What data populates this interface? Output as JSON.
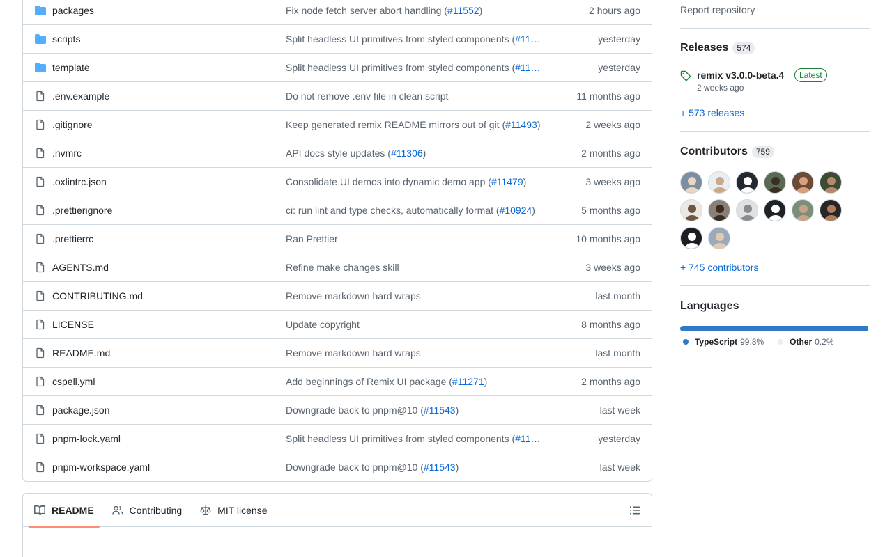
{
  "files": [
    {
      "type": "folder",
      "name": "packages",
      "message": "Fix node fetch server abort handling (",
      "pr": "#11552",
      "suffix": ")",
      "time": "2 hours ago"
    },
    {
      "type": "folder",
      "name": "scripts",
      "message": "Split headless UI primitives from styled components (",
      "pr": "#11…",
      "suffix": "",
      "time": "yesterday"
    },
    {
      "type": "folder",
      "name": "template",
      "message": "Split headless UI primitives from styled components (",
      "pr": "#11…",
      "suffix": "",
      "time": "yesterday"
    },
    {
      "type": "file",
      "name": ".env.example",
      "message": "Do not remove .env file in clean script",
      "pr": "",
      "suffix": "",
      "time": "11 months ago"
    },
    {
      "type": "file",
      "name": ".gitignore",
      "message": "Keep generated remix README mirrors out of git (",
      "pr": "#11493",
      "suffix": ")",
      "time": "2 weeks ago"
    },
    {
      "type": "file",
      "name": ".nvmrc",
      "message": "API docs style updates (",
      "pr": "#11306",
      "suffix": ")",
      "time": "2 months ago"
    },
    {
      "type": "file",
      "name": ".oxlintrc.json",
      "message": "Consolidate UI demos into dynamic demo app (",
      "pr": "#11479",
      "suffix": ")",
      "time": "3 weeks ago"
    },
    {
      "type": "file",
      "name": ".prettierignore",
      "message": "ci: run lint and type checks, automatically format (",
      "pr": "#10924",
      "suffix": ")",
      "time": "5 months ago"
    },
    {
      "type": "file",
      "name": ".prettierrc",
      "message": "Ran Prettier",
      "pr": "",
      "suffix": "",
      "time": "10 months ago"
    },
    {
      "type": "file",
      "name": "AGENTS.md",
      "message": "Refine make changes skill",
      "pr": "",
      "suffix": "",
      "time": "3 weeks ago"
    },
    {
      "type": "file",
      "name": "CONTRIBUTING.md",
      "message": "Remove markdown hard wraps",
      "pr": "",
      "suffix": "",
      "time": "last month"
    },
    {
      "type": "file",
      "name": "LICENSE",
      "message": "Update copyright",
      "pr": "",
      "suffix": "",
      "time": "8 months ago"
    },
    {
      "type": "file",
      "name": "README.md",
      "message": "Remove markdown hard wraps",
      "pr": "",
      "suffix": "",
      "time": "last month"
    },
    {
      "type": "file",
      "name": "cspell.yml",
      "message": "Add beginnings of Remix UI package (",
      "pr": "#11271",
      "suffix": ")",
      "time": "2 months ago"
    },
    {
      "type": "file",
      "name": "package.json",
      "message": "Downgrade back to pnpm@10 (",
      "pr": "#11543",
      "suffix": ")",
      "time": "last week"
    },
    {
      "type": "file",
      "name": "pnpm-lock.yaml",
      "message": "Split headless UI primitives from styled components (",
      "pr": "#11…",
      "suffix": "",
      "time": "yesterday"
    },
    {
      "type": "file",
      "name": "pnpm-workspace.yaml",
      "message": "Downgrade back to pnpm@10 (",
      "pr": "#11543",
      "suffix": ")",
      "time": "last week"
    }
  ],
  "readme_tabs": [
    {
      "label": "README",
      "icon": "book-icon"
    },
    {
      "label": "Contributing",
      "icon": "people-icon"
    },
    {
      "label": "MIT license",
      "icon": "law-icon"
    }
  ],
  "sidebar": {
    "report_label": "Report repository",
    "releases": {
      "title": "Releases",
      "count": "574",
      "latest_name": "remix v3.0.0-beta.4",
      "latest_badge": "Latest",
      "latest_date": "2 weeks ago",
      "more_label": "+ 573 releases"
    },
    "contributors": {
      "title": "Contributors",
      "count": "759",
      "more_label": "+ 745 contributors",
      "avatars": [
        {
          "bg": "#7d8ea3",
          "fg": "#e9d6c4"
        },
        {
          "bg": "#e9eef3",
          "fg": "#c9a98c"
        },
        {
          "bg": "#24292f",
          "fg": "#ffffff"
        },
        {
          "bg": "#5b6a52",
          "fg": "#3a2e25"
        },
        {
          "bg": "#6b4a36",
          "fg": "#d7a07c"
        },
        {
          "bg": "#3d4a34",
          "fg": "#b48b6a"
        },
        {
          "bg": "#ece7e0",
          "fg": "#6d5744"
        },
        {
          "bg": "#8a7f77",
          "fg": "#3b2b22"
        },
        {
          "bg": "#dfe2e4",
          "fg": "#8b8b8b"
        },
        {
          "bg": "#1f2328",
          "fg": "#ffffff"
        },
        {
          "bg": "#7a8f7a",
          "fg": "#c5a288"
        },
        {
          "bg": "#262626",
          "fg": "#b07c5e"
        },
        {
          "bg": "#1b1f24",
          "fg": "#ffffff"
        },
        {
          "bg": "#9aa9bb",
          "fg": "#e6c8ae"
        }
      ]
    },
    "languages": {
      "title": "Languages",
      "items": [
        {
          "name": "TypeScript",
          "pct": "99.8%",
          "value": 99.8,
          "color": "#3178c6"
        },
        {
          "name": "Other",
          "pct": "0.2%",
          "value": 0.2,
          "color": "#ededed"
        }
      ]
    }
  }
}
